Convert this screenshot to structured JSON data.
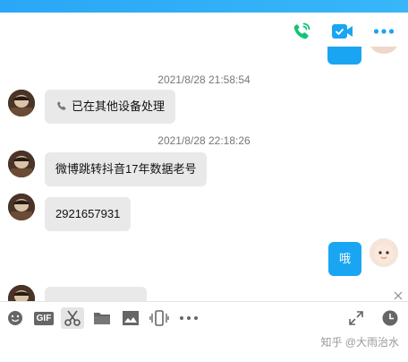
{
  "header": {
    "phone_icon": "phone-icon",
    "video_icon": "video-camera-icon",
    "more_icon": "more-icon",
    "accent": "#2aa7f6",
    "call_green": "#13c37a"
  },
  "messages": [
    {
      "type": "timestamp",
      "text": "2021/8/28 21:58:54"
    },
    {
      "type": "left",
      "icon": "phone-icon",
      "text": "已在其他设备处理"
    },
    {
      "type": "timestamp",
      "text": "2021/8/28 22:18:26"
    },
    {
      "type": "left",
      "text": "微博跳转抖音17年数据老号"
    },
    {
      "type": "left",
      "text": "2921657931"
    },
    {
      "type": "right",
      "text": "哦"
    }
  ],
  "toolbar": {
    "items": [
      "emoji-icon",
      "gif-icon",
      "scissors-icon",
      "folder-icon",
      "image-icon",
      "shake-icon",
      "more-icon"
    ],
    "right": [
      "expand-icon",
      "clock-icon"
    ],
    "gif_label": "GIF"
  },
  "watermark": "知乎 @大雨治水"
}
